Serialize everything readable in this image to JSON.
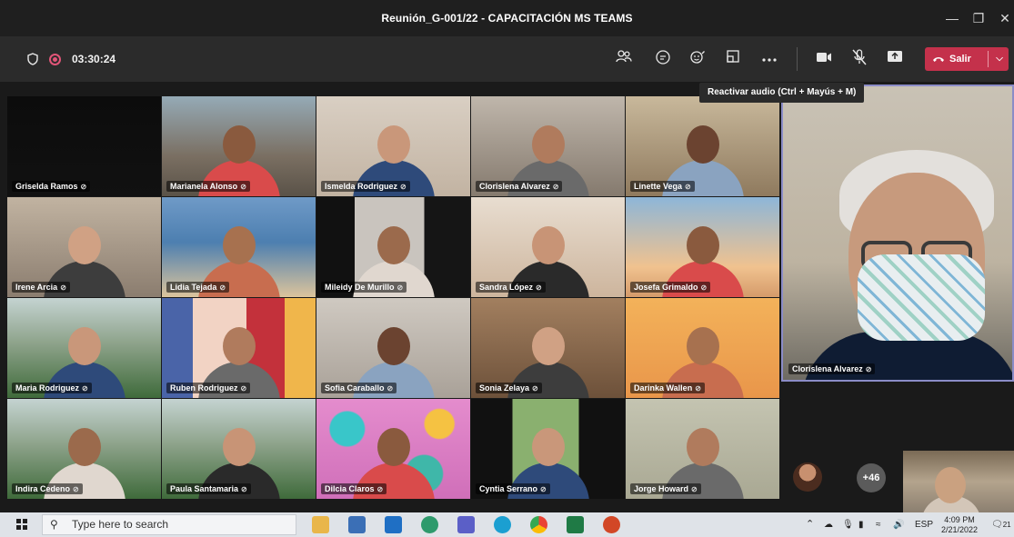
{
  "window": {
    "title": "Reunión_G-001/22 - CAPACITACIÓN MS TEAMS",
    "minimize": "—",
    "maximize": "❐",
    "close": "✕"
  },
  "toolbar": {
    "timer": "03:30:24",
    "icons": [
      "people-icon",
      "chat-icon",
      "reactions-icon",
      "rooms-icon",
      "more-icon",
      "camera-icon",
      "mic-muted-icon",
      "share-icon"
    ],
    "leave_label": "Salir",
    "tooltip": "Reactivar audio (Ctrl + Mayús + M)"
  },
  "participants": [
    {
      "name": "Griselda  Ramos",
      "bg": "#0e0e0e",
      "scene": "dark"
    },
    {
      "name": "Marianela  Alonso",
      "bg": "#7c8a90",
      "scene": "ring"
    },
    {
      "name": "Ismelda  Rodriguez",
      "bg": "#c9b8a7",
      "scene": "red"
    },
    {
      "name": "Clorislena Alvarez",
      "bg": "#9a8f84",
      "scene": "mask"
    },
    {
      "name": "Linette Vega",
      "bg": "#9f8a68",
      "scene": "office"
    },
    {
      "name": "Irene  Arcia",
      "bg": "#a99b8b",
      "scene": "room"
    },
    {
      "name": "Lidia  Tejada",
      "bg": "#4d7fb0",
      "scene": "beach"
    },
    {
      "name": "Mileidy De Murillo",
      "bg": "#1b1b1b",
      "scene": "dark2"
    },
    {
      "name": "Sandra  López",
      "bg": "#d3c1a8",
      "scene": "pink"
    },
    {
      "name": "Josefa  Grimaldo",
      "bg": "#86a7c4",
      "scene": "sunset"
    },
    {
      "name": "Maria  Rodriguez",
      "bg": "#6c8a6a",
      "scene": "mountains"
    },
    {
      "name": "Ruben  Rodriguez",
      "bg": "#c0454f",
      "scene": "colorful"
    },
    {
      "name": "Sofia  Caraballo",
      "bg": "#b9b3ab",
      "scene": "plain"
    },
    {
      "name": "Sonia  Zelaya",
      "bg": "#8c6a4e",
      "scene": "living"
    },
    {
      "name": "Darinka  Wallen",
      "bg": "#e8a04a",
      "scene": "orange"
    },
    {
      "name": "Indira  Cedeno",
      "bg": "#6c8a6a",
      "scene": "mountains"
    },
    {
      "name": "Paula  Santamaria",
      "bg": "#6c8a6a",
      "scene": "mountains"
    },
    {
      "name": "Dilcia  Claros",
      "bg": "#d77fc1",
      "scene": "bubbles"
    },
    {
      "name": "Cyntia  Serrano",
      "bg": "#141414",
      "scene": "tree"
    },
    {
      "name": "Jorge  Howard",
      "bg": "#b8b9a4",
      "scene": "plain2"
    }
  ],
  "featured": {
    "name": "Clorislena Alvarez"
  },
  "overflow_count": "+46",
  "taskbar": {
    "search_placeholder": "Type here to search",
    "tray_lang": "ESP",
    "time": "4:09 PM",
    "date": "2/21/2022",
    "notification_count": "21"
  }
}
